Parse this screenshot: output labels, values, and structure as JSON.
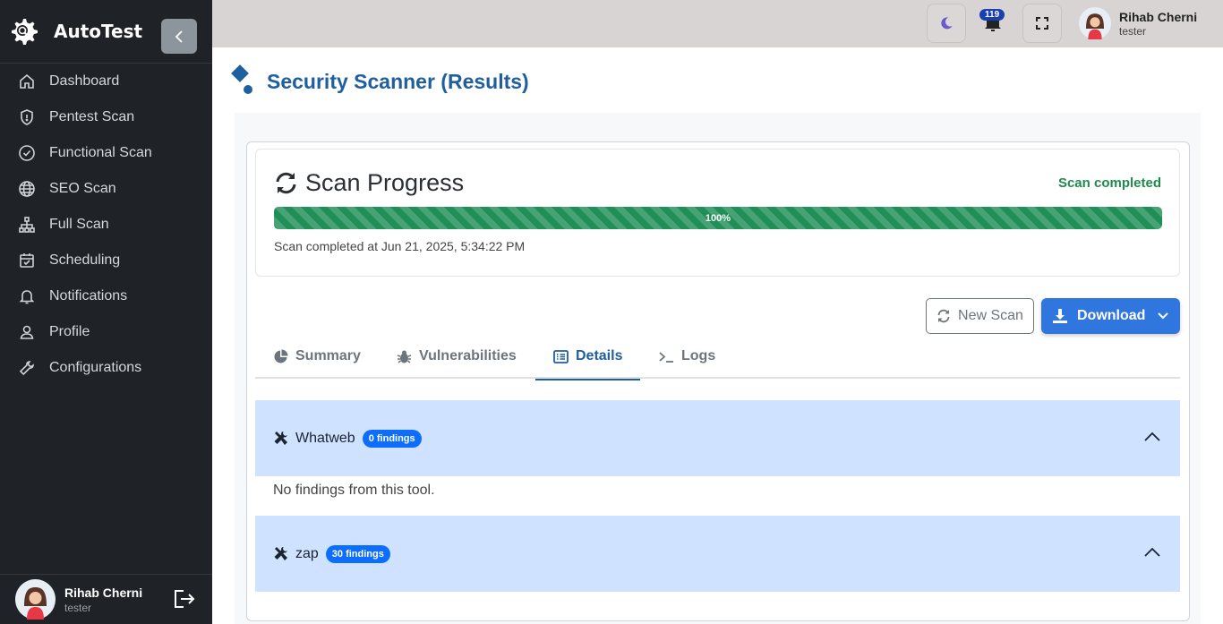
{
  "app": {
    "name": "AutoTest"
  },
  "sidebar": {
    "items": [
      {
        "label": "Dashboard",
        "icon": "home-icon"
      },
      {
        "label": "Pentest Scan",
        "icon": "shield-icon"
      },
      {
        "label": "Functional Scan",
        "icon": "check-circle-icon"
      },
      {
        "label": "SEO Scan",
        "icon": "globe-icon"
      },
      {
        "label": "Full Scan",
        "icon": "sitemap-icon"
      },
      {
        "label": "Scheduling",
        "icon": "calendar-check-icon"
      },
      {
        "label": "Notifications",
        "icon": "bell-icon"
      },
      {
        "label": "Profile",
        "icon": "user-icon"
      },
      {
        "label": "Configurations",
        "icon": "wrench-icon"
      }
    ],
    "user": {
      "name": "Rihab Cherni",
      "role": "tester"
    }
  },
  "topbar": {
    "notification_count": "119",
    "user": {
      "name": "Rihab Cherni",
      "role": "tester"
    }
  },
  "page": {
    "title": "Security Scanner (Results)"
  },
  "progress": {
    "title": "Scan Progress",
    "status": "Scan completed",
    "percent": 100,
    "percent_label": "100%",
    "completed_text": "Scan completed at Jun 21, 2025, 5:34:22 PM"
  },
  "actions": {
    "new_scan": "New Scan",
    "download": "Download"
  },
  "tabs": [
    {
      "label": "Summary"
    },
    {
      "label": "Vulnerabilities"
    },
    {
      "label": "Details",
      "active": true
    },
    {
      "label": "Logs"
    }
  ],
  "details": [
    {
      "tool": "Whatweb",
      "badge": "0 findings",
      "body": "No findings from this tool."
    },
    {
      "tool": "zap",
      "badge": "30 findings",
      "body": ""
    }
  ],
  "colors": {
    "accent": "#1f5fa0",
    "success": "#1f8a4c",
    "primary": "#2f76de",
    "sidebar": "#1f2226"
  }
}
